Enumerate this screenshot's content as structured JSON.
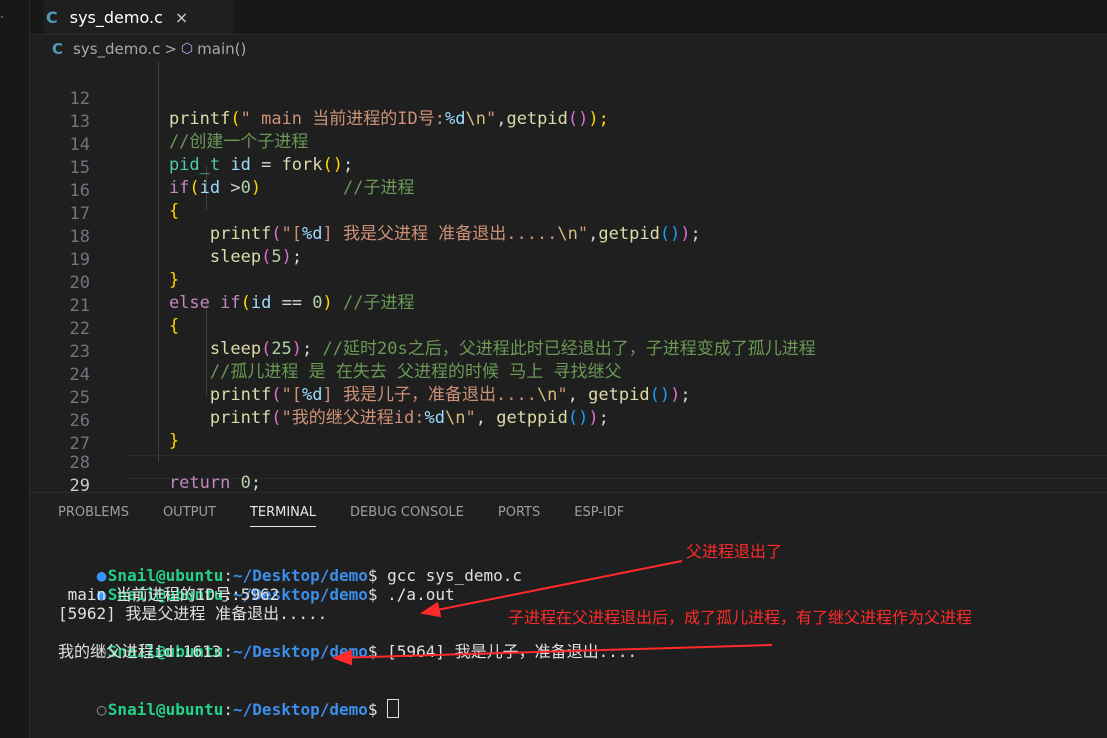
{
  "tab": {
    "icon": "C",
    "name": "sys_demo.c",
    "close": "×"
  },
  "breadcrumb": {
    "file": "sys_demo.c",
    "sep": ">",
    "symbol": "main()"
  },
  "code": {
    "l12": {
      "n": "12",
      "indent": "    ",
      "a": "printf",
      "b": "(",
      "c": "\" main 当前进程的ID号:",
      "d": "%d",
      "e": "\\n",
      "f": "\"",
      "g": ",",
      "h": "getpid",
      "i": "()",
      "j": ");"
    },
    "l13": {
      "n": "13",
      "text": "    //创建一个子进程"
    },
    "l14": {
      "n": "14",
      "a": "    pid_t",
      "b": " id ",
      "c": "=",
      "d": " fork",
      "e": "()",
      "f": ";"
    },
    "l15": {
      "n": "15",
      "a": "    if",
      "b": "(",
      "c": "id",
      "d": " >",
      "e": "0",
      "f": ")",
      "g": "        //子进程"
    },
    "l16": {
      "n": "16",
      "a": "    {"
    },
    "l17": {
      "n": "17",
      "a": "        printf",
      "b": "(",
      "c": "\"[",
      "d": "%d",
      "e": "] 我是父进程 准备退出.....",
      "f": "\\n",
      "g": "\"",
      "h": ",",
      "i": "getpid",
      "j": "()",
      "k": ")",
      "l": ";"
    },
    "l18": {
      "n": "18",
      "a": "        sleep",
      "b": "(",
      "c": "5",
      "d": ")",
      "e": ";"
    },
    "l19": {
      "n": "19",
      "a": "    }"
    },
    "l20": {
      "n": "20",
      "a": "    else if",
      "b": "(",
      "c": "id",
      "d": " == ",
      "e": "0",
      "f": ")",
      "g": " //子进程"
    },
    "l21": {
      "n": "21",
      "a": "    {"
    },
    "l22": {
      "n": "22",
      "a": "        sleep",
      "b": "(",
      "c": "25",
      "d": ")",
      "e": ";",
      "f": " //延时20s之后，父进程此时已经退出了，子进程变成了孤儿进程"
    },
    "l23": {
      "n": "23",
      "text": "        //孤儿进程 是 在失去 父进程的时候 马上 寻找继父"
    },
    "l24": {
      "n": "24",
      "a": "        printf",
      "b": "(",
      "c": "\"[",
      "d": "%d",
      "e": "] 我是儿子，准备退出....",
      "f": "\\n",
      "g": "\"",
      "h": ", ",
      "i": "getpid",
      "j": "()",
      "k": ")",
      "l": ";"
    },
    "l25": {
      "n": "25",
      "a": "        printf",
      "b": "(",
      "c": "\"我的继父进程id:",
      "d": "%d",
      "e": "\\n",
      "f": "\"",
      "g": ", ",
      "h": "getppid",
      "i": "()",
      "j": ")",
      "k": ";"
    },
    "l26": {
      "n": "26",
      "a": "    }"
    },
    "l27": {
      "n": "27"
    },
    "l28": {
      "n": "28",
      "a": "    return",
      "b": " 0",
      "c": ";"
    },
    "l29": {
      "n": "29",
      "a": "}"
    }
  },
  "panel_tabs": [
    "PROBLEMS",
    "OUTPUT",
    "TERMINAL",
    "DEBUG CONSOLE",
    "PORTS",
    "ESP-IDF"
  ],
  "terminal": {
    "user": "Snail@ubuntu",
    "colon": ":",
    "path": "~/Desktop/demo",
    "prompt": "$",
    "cmd1": " gcc sys_demo.c",
    "cmd2": " ./a.out",
    "out1": " main 当前进程的ID号:5962",
    "out2": "[5962] 我是父进程 准备退出.....",
    "cmd3_out": " [5964] 我是儿子，准备退出....",
    "out3": "我的继父进程id:1613"
  },
  "annotations": {
    "note1": "父进程退出了",
    "note2": "子进程在父进程退出后，成了孤儿进程，有了继父进程作为父进程",
    "color": "#ff2a2a"
  }
}
